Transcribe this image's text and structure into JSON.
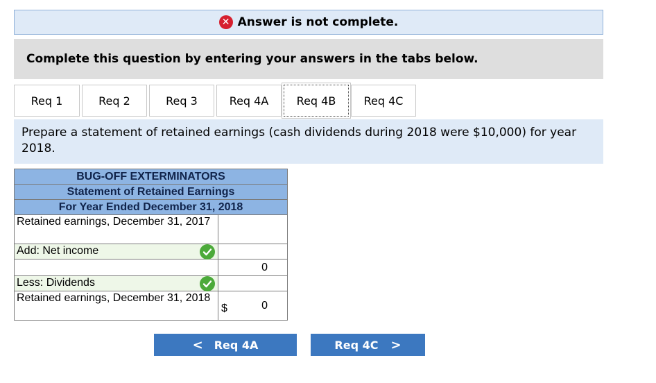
{
  "banner": {
    "icon": "x-circle-icon",
    "text": "Answer is not complete."
  },
  "instructions": "Complete this question by entering your answers in the tabs below.",
  "tabs": [
    {
      "label": "Req 1",
      "active": false
    },
    {
      "label": "Req 2",
      "active": false
    },
    {
      "label": "Req 3",
      "active": false
    },
    {
      "label": "Req 4A",
      "active": false
    },
    {
      "label": "Req 4B",
      "active": true
    },
    {
      "label": "Req 4C",
      "active": false
    }
  ],
  "prompt": "Prepare a statement of retained earnings (cash dividends during 2018 were $10,000) for year 2018.",
  "statement": {
    "company": "BUG-OFF EXTERMINATORS",
    "title": "Statement of Retained Earnings",
    "period": "For Year Ended December 31, 2018",
    "rows": [
      {
        "label": "Retained earnings, December 31, 2017",
        "value": ""
      },
      {
        "label": "Add: Net income",
        "value": ""
      },
      {
        "label": "",
        "value": "0"
      },
      {
        "label": "Less: Dividends",
        "value": ""
      },
      {
        "label": "Retained earnings, December 31, 2018",
        "currency": "$",
        "value": "0"
      }
    ]
  },
  "nav": {
    "prev_label": "Req 4A",
    "next_label": "Req 4C"
  },
  "colors": {
    "accent": "#3c78c0",
    "header_fill": "#8db4e3",
    "banner_fill": "#dfeaf7",
    "error": "#d6202f",
    "check": "#4caa3a"
  }
}
